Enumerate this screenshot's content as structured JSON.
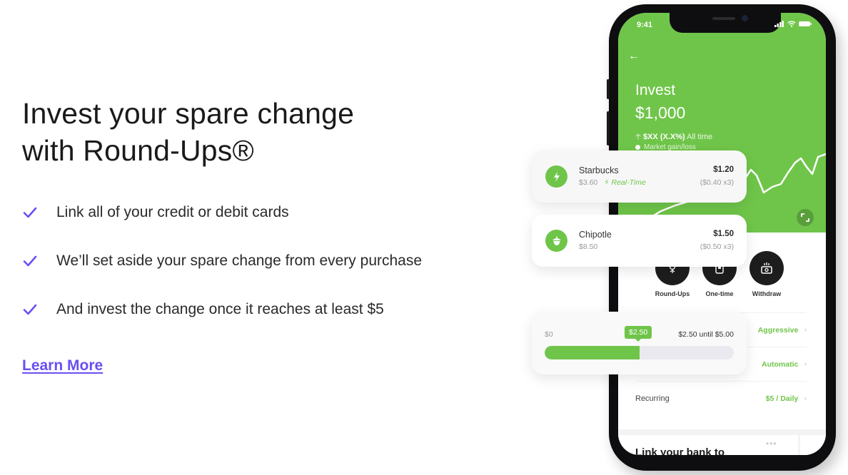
{
  "hero": {
    "headline_line1": "Invest your spare change",
    "headline_line2": "with Round-Ups®",
    "features": [
      "Link all of your credit or debit cards",
      "We’ll set aside your spare change from every purchase",
      "And invest the change once it reaches at least $5"
    ],
    "learn_more": "Learn More",
    "accent_color": "#6a4ff2"
  },
  "phone": {
    "status_time": "9:41",
    "back_icon": "arrow-left-icon",
    "title": "Invest",
    "balance": "$1,000",
    "gain_amount": "$XX (X.X%)",
    "gain_period": "All time",
    "legend": "Market gain/loss",
    "brand_color": "#6fc549",
    "actions": [
      {
        "label": "Round-Ups",
        "icon": "acorn-sprout-icon"
      },
      {
        "label": "One-time",
        "icon": "phone-deposit-icon"
      },
      {
        "label": "Withdraw",
        "icon": "cash-withdraw-icon"
      }
    ],
    "settings": [
      {
        "label": "",
        "value": "Aggressive"
      },
      {
        "label": "",
        "value": "Automatic"
      },
      {
        "label": "Recurring",
        "value": "$5 / Daily"
      }
    ],
    "bank_card_title": "Link your bank to"
  },
  "transactions": [
    {
      "merchant": "Starbucks",
      "price": "$3.60",
      "tag": "Real-Time",
      "roundup": "$1.20",
      "detail": "($0.40 x3)",
      "icon": "lightning-icon"
    },
    {
      "merchant": "Chipotle",
      "price": "$8.50",
      "tag": "",
      "roundup": "$1.50",
      "detail": "($0.50 x3)",
      "icon": "acorn-icon"
    }
  ],
  "progress": {
    "min_label": "$0",
    "current_label": "$2.50",
    "status": "$2.50 until $5.00",
    "fraction": 0.5
  }
}
